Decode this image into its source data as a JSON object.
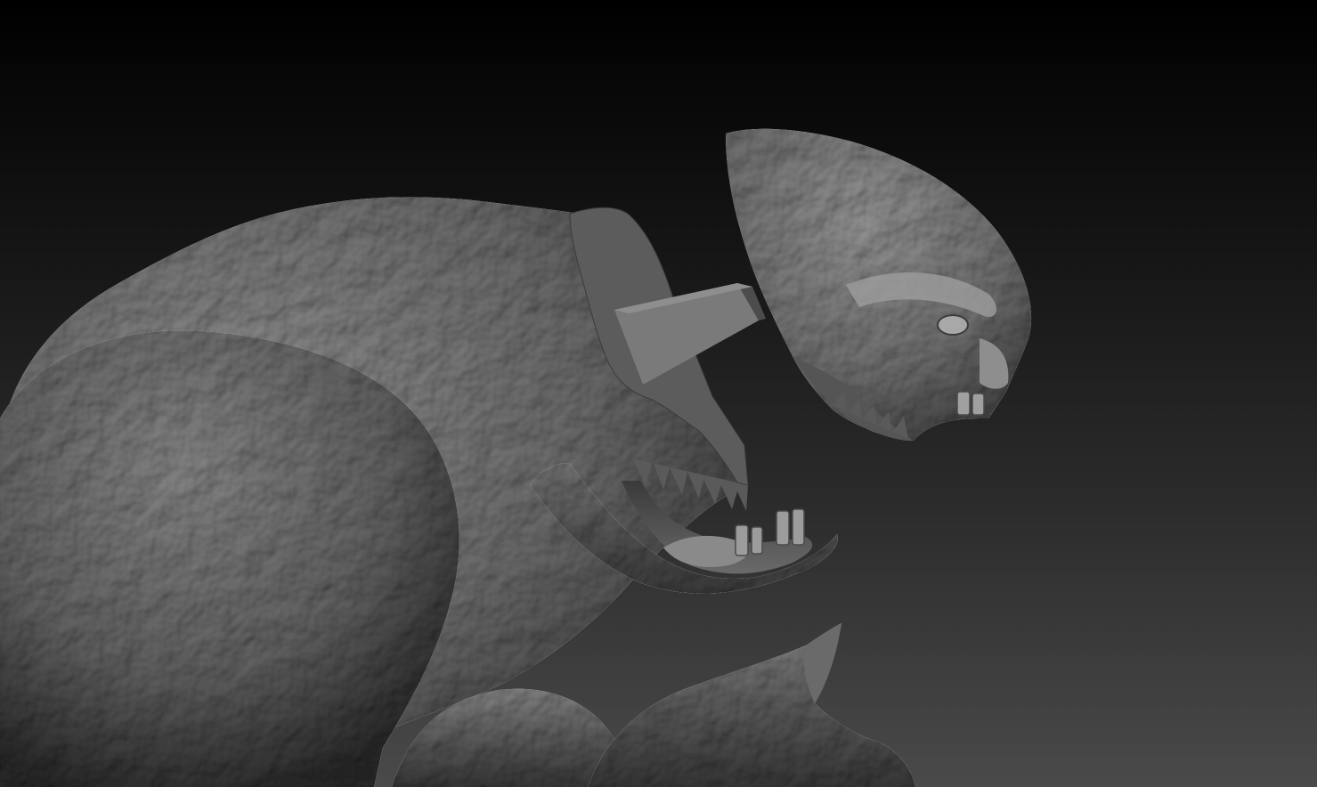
{
  "viewport": {
    "background_top": "#000000",
    "background_bottom": "#4a4a4a",
    "material_light": "#8a8a8a",
    "material_mid": "#686868",
    "material_dark": "#2e2e2e",
    "cut_face": "#5c5c5c"
  }
}
